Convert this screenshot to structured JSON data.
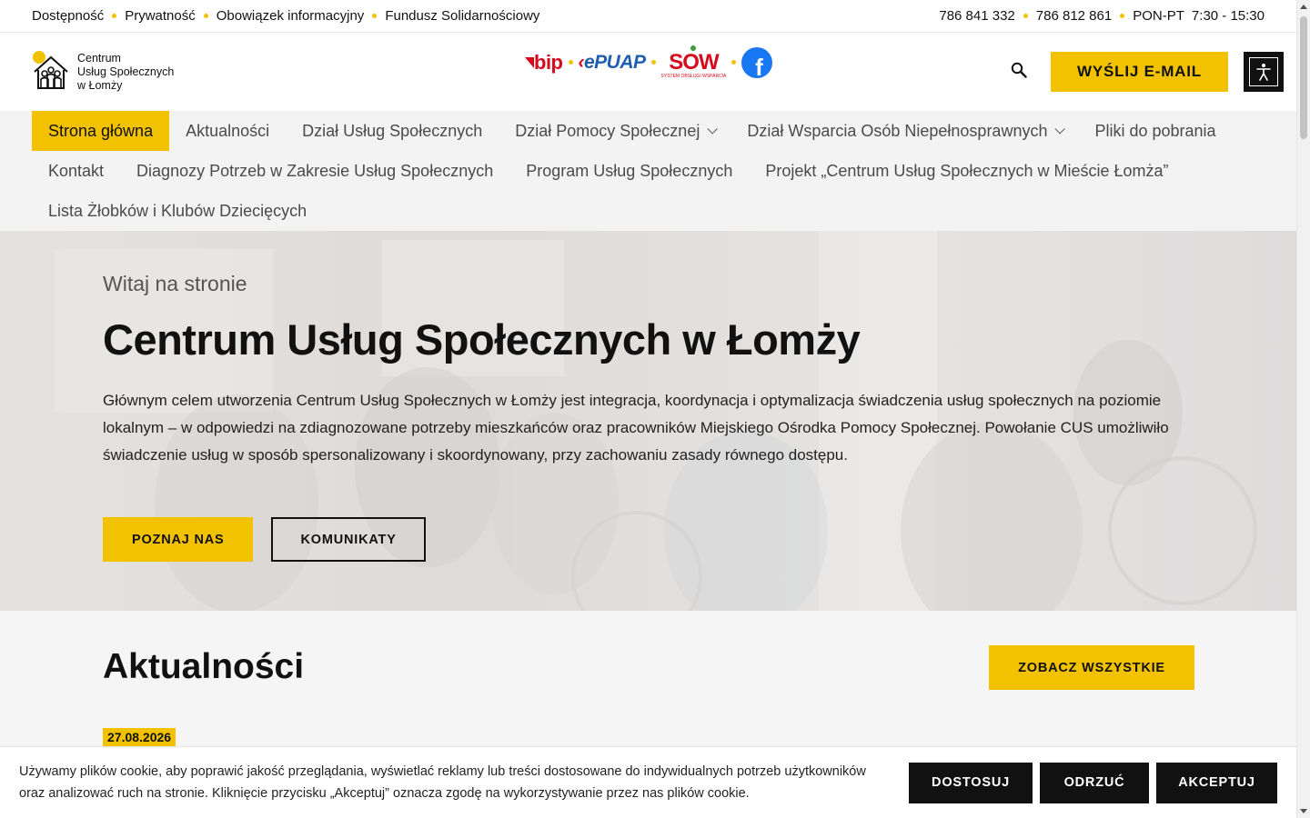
{
  "topbar": {
    "links": [
      "Dostępność",
      "Prywatność",
      "Obowiązek informacyjny",
      "Fundusz Solidarnościowy"
    ],
    "phone1": "786 841 332",
    "phone2": "786 812 861",
    "hours": "PON-PT  7:30 - 15:30"
  },
  "header": {
    "logo_line1": "Centrum",
    "logo_line2": "Usług Społecznych",
    "logo_line3": "w Łomży",
    "partner_bip": "bip",
    "partner_epuap": "ePUAP",
    "partner_sow": "SOW",
    "partner_sow_sub": "SYSTEM OBSŁUGI WSPARCIA",
    "partner_fb": "f",
    "email_button": "WYŚLIJ E-MAIL"
  },
  "nav": {
    "items": [
      {
        "label": "Strona główna"
      },
      {
        "label": "Aktualności"
      },
      {
        "label": "Dział Usług Społecznych"
      },
      {
        "label": "Dział Pomocy Społecznej"
      },
      {
        "label": "Dział Wsparcia Osób Niepełnosprawnych"
      },
      {
        "label": "Pliki do pobrania"
      },
      {
        "label": "Kontakt"
      },
      {
        "label": "Diagnozy Potrzeb w Zakresie Usług Społecznych"
      },
      {
        "label": "Program Usług Społecznych"
      },
      {
        "label": "Projekt „Centrum Usług Społecznych w Mieście Łomża”"
      },
      {
        "label": "Lista Żłobków i Klubów Dziecięcych"
      }
    ]
  },
  "hero": {
    "kicker": "Witaj na stronie",
    "title": "Centrum Usług Społecznych w Łomży",
    "text": "Głównym celem utworzenia Centrum Usług Społecznych w Łomży jest integracja, koordynacja i optymalizacja świadczenia usług społecznych na poziomie lokalnym – w odpowiedzi na zdiagnozowane potrzeby mieszkańców oraz pracowników Miejskiego Ośrodka Pomocy Społecznej. Powołanie CUS umożliwiło świadczenie usług w sposób spersonalizowany i skoordynowany, przy zachowaniu zasady równego dostępu.",
    "button_about": "POZNAJ NAS",
    "button_news": "KOMUNIKATY"
  },
  "news": {
    "title": "Aktualności",
    "see_all": "ZOBACZ WSZYSTKIE",
    "first_date": "27.08.2026"
  },
  "cookie": {
    "text": "Używamy plików cookie, aby poprawić jakość przeglądania, wyświetlać reklamy lub treści dostosowane do indywidualnych potrzeb użytkowników oraz analizować ruch na stronie. Kliknięcie przycisku „Akceptuj” oznacza zgodę na wykorzystywanie przez nas plików cookie.",
    "customize": "DOSTOSUJ",
    "reject": "ODRZUĆ",
    "accept": "AKCEPTUJ"
  },
  "colors": {
    "accent": "#f2c200",
    "dark": "#111111",
    "facebook": "#1877f2",
    "bip_red": "#d7091c",
    "epuap_blue": "#1f5fb0"
  },
  "icons": [
    "search-icon",
    "accessibility-icon",
    "chevron-down-icon",
    "facebook-icon",
    "logo-icon"
  ]
}
